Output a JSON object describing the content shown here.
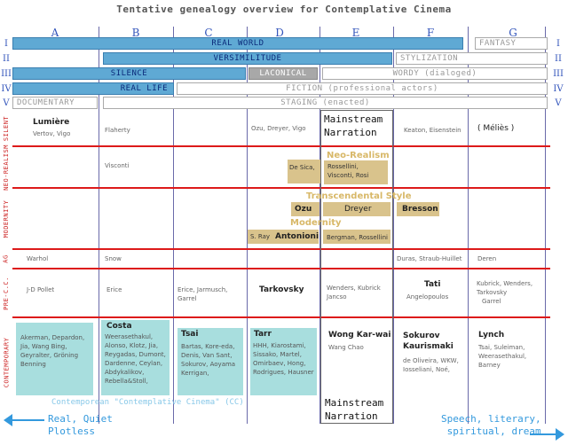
{
  "title": "Tentative genealogy overview for Contemplative Cinema",
  "columns": [
    "A",
    "B",
    "C",
    "D",
    "E",
    "F",
    "G"
  ],
  "row_numerals": [
    "I",
    "II",
    "III",
    "IV",
    "V"
  ],
  "bands": {
    "real_world": "REAL WORLD",
    "fantasy": "FANTASY",
    "versimilitude": "VERSIMILITUDE",
    "stylization": "STYLIZATION",
    "silence": "SILENCE",
    "laconical": "LACONICAL",
    "wordy": "WORDY (dialoged)",
    "real_life": "REAL LIFE",
    "fiction": "FICTION (professional actors)",
    "documentary": "DOCUMENTARY",
    "staging": "STAGING (enacted)"
  },
  "row_labels": {
    "silent": "SILENT",
    "neo_realism": "NEO-REALISM",
    "modernity": "MODERNITY",
    "ag": "AG",
    "pre_cc": "PRE-C.C.",
    "contemporary": "CONTEMPORARY"
  },
  "silent": {
    "lumiere": "Lumière",
    "vertov": "Vertov, Vigo",
    "flaherty": "Flaherty",
    "ozu": "Ozu, Dreyer, Vigo",
    "keaton": "Keaton, Eisenstein",
    "melies": "( Méliès )"
  },
  "mainstream": {
    "top": [
      "Mainstream",
      "Narration"
    ],
    "bottom": [
      "Mainstream",
      "Narration"
    ]
  },
  "neorealism": {
    "visconti": "Visconti",
    "label": "Neo-Realism",
    "desica": "De Sica,",
    "rossellini": [
      "Rossellini,",
      "Visconti, Rosi"
    ]
  },
  "modernity": {
    "transcendental": "Transcendental Style",
    "ozu": "Ozu",
    "dreyer": "Dreyer",
    "bresson": "Bresson",
    "label": "Modernity",
    "sray": "S. Ray",
    "antonioni": "Antonioni",
    "bergman": "Bergman, Rossellini"
  },
  "ag": {
    "warhol": "Warhol",
    "snow": "Snow",
    "duras": "Duras, Straub-Huillet",
    "deren": "Deren"
  },
  "precc": {
    "jdpollet": "J-D Pollet",
    "erice": "Erice",
    "erice_jarmusch": [
      "Erice, Jarmusch,",
      "Garrel"
    ],
    "tarkovsky": "Tarkovsky",
    "wenders": [
      "Wenders, Kubrick",
      "Jancso"
    ],
    "tati": "Tati",
    "angelopoulos": "Angelopoulos",
    "kubrick": [
      "Kubrick, Wenders,",
      "Tarkovsky",
      "Garrel"
    ]
  },
  "contemporary": {
    "a": [
      "Akerman, Depardon,",
      "Jia, Wang Bing,",
      "Geyralter, Gröning",
      "Benning"
    ],
    "b_head": "Costa",
    "b": [
      "Weerasethakul,",
      "Alonso, Klotz, Jia,",
      "Reygadas, Dumont,",
      "Dardenne, Ceylan,",
      "Abdykalikov,",
      "Rebella&Stoll,"
    ],
    "c_head": "Tsai",
    "c": [
      "Bartas, Kore-eda,",
      "Denis, Van Sant,",
      "Sokurov, Aoyama",
      "Kerrigan,"
    ],
    "d_head": "Tarr",
    "d": [
      "HHH, Kiarostami,",
      "Sissako, Martel,",
      "Omirbaev, Hong,",
      "Rodrigues, Hausner"
    ],
    "e_head": "Wong Kar-wai",
    "e": [
      "Wang Chao"
    ],
    "f_head": [
      "Sokurov",
      "Kaurismaki"
    ],
    "f": [
      "de Oliveira, WKW,",
      "Iosseliani, Noé,"
    ],
    "g_head": "Lynch",
    "g": [
      "Tsai, Suleiman,",
      "Weerasethakul,",
      "Barney"
    ]
  },
  "cc_label": "Contemporean \"Contemplative Cinema\" (CC)",
  "bottom_left": [
    "Real, Quiet",
    "Plotless"
  ],
  "bottom_right": [
    "Speech, literary,",
    "spiritual, dream"
  ]
}
